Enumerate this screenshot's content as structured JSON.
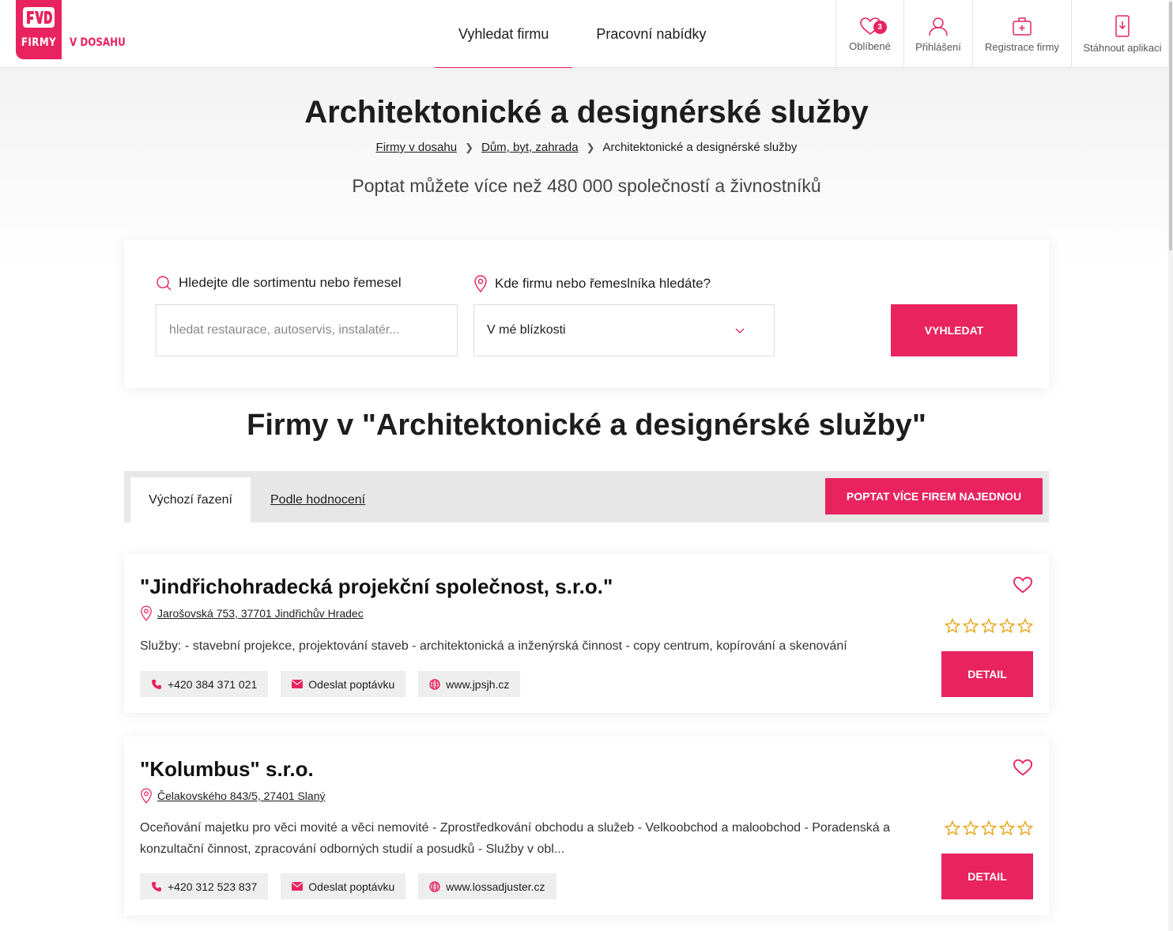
{
  "brand": {
    "firmy": "FIRMY",
    "vdosahu": "V DOSAHU",
    "accent_color": "#e8235f"
  },
  "nav": {
    "items": [
      {
        "label": "Vyhledat firmu",
        "active": true
      },
      {
        "label": "Pracovní nabídky",
        "active": false
      }
    ]
  },
  "header_actions": {
    "favorites": {
      "label": "Oblíbené",
      "count": "3",
      "icon": "heart-icon"
    },
    "login": {
      "label": "Přihlášení",
      "icon": "user-icon"
    },
    "register": {
      "label": "Registrace firmy",
      "icon": "briefcase-plus-icon"
    },
    "download": {
      "label": "Stáhnout aplikaci",
      "icon": "phone-download-icon"
    }
  },
  "hero": {
    "title": "Architektonické a designérské služby",
    "breadcrumb": [
      "Firmy v dosahu",
      "Dům, byt, zahrada",
      "Architektonické a designérské služby"
    ],
    "subtitle": "Poptat můžete více než 480 000 společností a živnostníků"
  },
  "search": {
    "what_label": "Hledejte dle sortimentu nebo řemesel",
    "what_placeholder": "hledat restaurace, autoservis, instalatér...",
    "where_label": "Kde firmu nebo řemeslníka hledáte?",
    "where_value": "V mé blízkosti",
    "submit_label": "VYHLEDAT"
  },
  "list": {
    "title": "Firmy v \"Architektonické a designérské služby\"",
    "sort_tabs": [
      "Výchozí řazení",
      "Podle hodnocení"
    ],
    "multi_button": "POPTAT VÍCE FIREM NAJEDNOU"
  },
  "companies": [
    {
      "name": "\"Jindřichohradecká projekční společnost, s.r.o.\"",
      "address": "Jarošovská 753, 37701 Jindřichův Hradec",
      "description": "Služby: - stavební projekce, projektování staveb - architektonická a inženýrská činnost - copy centrum, kopírování a skenování",
      "phone": "+420 384 371 021",
      "inquiry": "Odeslat poptávku",
      "web": "www.jpsjh.cz",
      "rating": 0,
      "detail": "DETAIL"
    },
    {
      "name": "\"Kolumbus\" s.r.o.",
      "address": "Čelakovského 843/5, 27401 Slaný",
      "description": "Oceňování majetku pro věci movité a věci nemovité - Zprostředkování obchodu a služeb - Velkoobchod a maloobchod - Poradenská a konzultační činnost, zpracování odborných studií a posudků - Služby v obl...",
      "phone": "+420 312 523 837",
      "inquiry": "Odeslat poptávku",
      "web": "www.lossadjuster.cz",
      "rating": 0,
      "detail": "DETAIL"
    }
  ]
}
